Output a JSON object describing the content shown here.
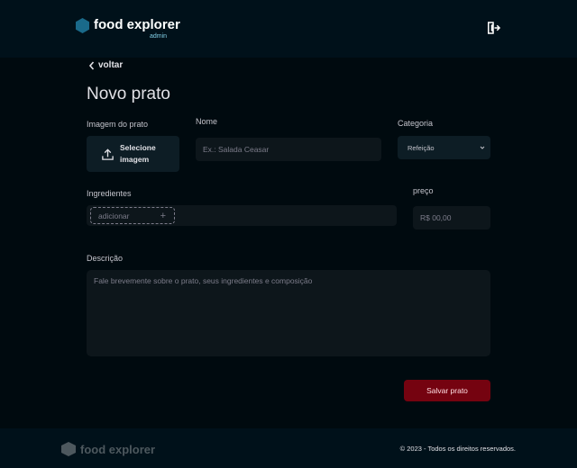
{
  "header": {
    "brand": "food explorer",
    "role": "admin",
    "logout_icon": "logout-icon"
  },
  "nav": {
    "back_label": "voltar"
  },
  "page": {
    "title": "Novo prato"
  },
  "form": {
    "image": {
      "label": "Imagem do prato",
      "button_label": "Selecione imagem",
      "icon": "upload-icon"
    },
    "name": {
      "label": "Nome",
      "placeholder": "Ex.: Salada Ceasar",
      "value": ""
    },
    "category": {
      "label": "Categoria",
      "selected": "Refeição"
    },
    "ingredients": {
      "label": "Ingredientes",
      "new_placeholder": "adicionar",
      "add_symbol": "+"
    },
    "price": {
      "label": "preço",
      "placeholder": "R$ 00,00",
      "value": ""
    },
    "description": {
      "label": "Descrição",
      "placeholder": "Fale brevemente sobre o prato, seus ingredientes e composição",
      "value": ""
    },
    "save_label": "Salvar prato"
  },
  "footer": {
    "brand": "food explorer",
    "copyright": "© 2023 - Todos os direitos reservados."
  },
  "colors": {
    "background": "#000a0f",
    "header": "#00111a",
    "accent": "#750310",
    "logo": "#1a6a8a"
  }
}
